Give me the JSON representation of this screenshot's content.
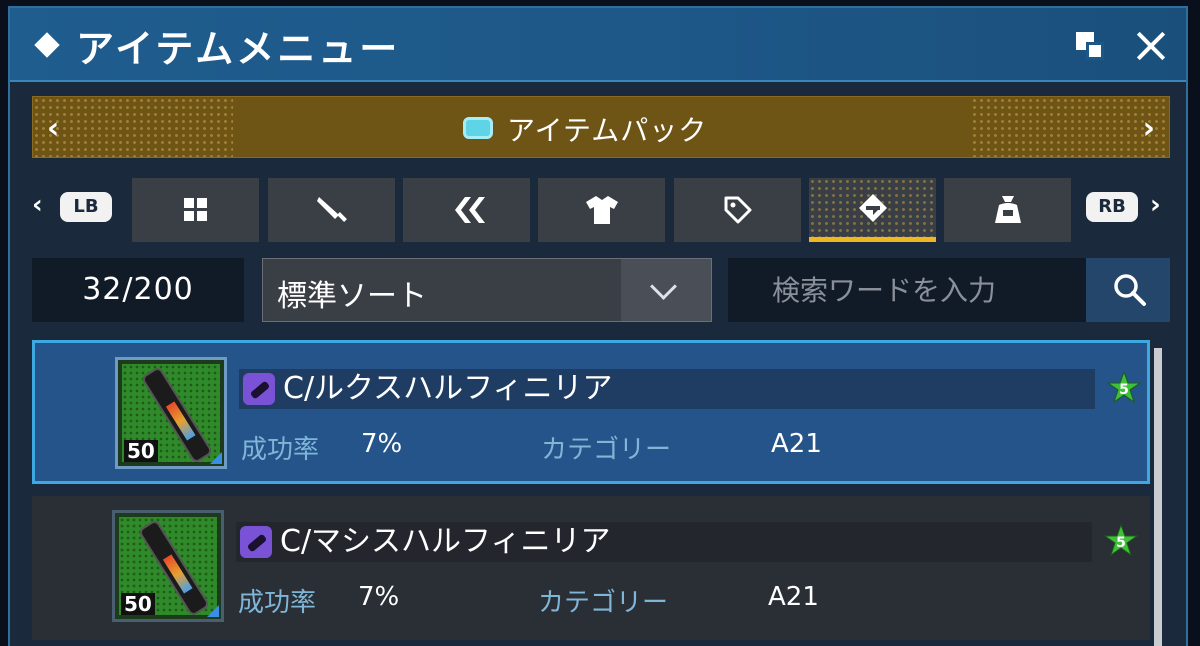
{
  "window": {
    "title": "アイテムメニュー"
  },
  "pack": {
    "label": "アイテムパック",
    "prev_arrow": "‹",
    "next_arrow": "›"
  },
  "tabs": {
    "lb": "LB",
    "rb": "RB",
    "prev_arrow": "‹",
    "next_arrow": "›",
    "active_index": 5,
    "items": [
      {
        "icon": "grid-icon"
      },
      {
        "icon": "sword-icon"
      },
      {
        "icon": "double-chevron-icon"
      },
      {
        "icon": "shirt-icon"
      },
      {
        "icon": "tag-icon"
      },
      {
        "icon": "gem-icon"
      },
      {
        "icon": "bag-icon"
      }
    ]
  },
  "inventory": {
    "count": "32/200"
  },
  "sort": {
    "selected": "標準ソート"
  },
  "search": {
    "placeholder": "検索ワードを入力"
  },
  "items": [
    {
      "name": "C/ルクスハルフィニリア",
      "level": "50",
      "success_label": "成功率",
      "success_value": "7%",
      "category_label": "カテゴリー",
      "category_value": "A21",
      "rarity": "5",
      "selected": true
    },
    {
      "name": "C/マシスハルフィニリア",
      "level": "50",
      "success_label": "成功率",
      "success_value": "7%",
      "category_label": "カテゴリー",
      "category_value": "A21",
      "rarity": "5",
      "selected": false
    }
  ],
  "colors": {
    "accent": "#f0b820",
    "selection": "#3ea8e0",
    "stat_label": "#7fb6d8"
  }
}
